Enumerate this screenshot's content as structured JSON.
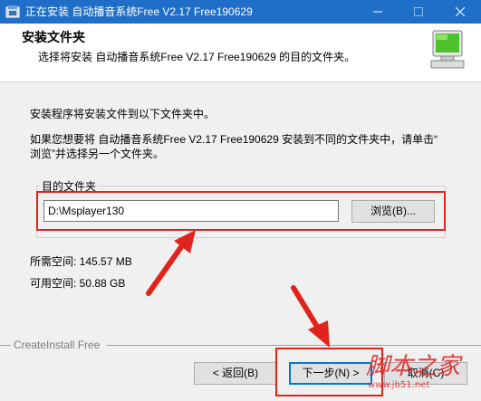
{
  "window": {
    "title": "正在安装 自动播音系统Free V2.17 Free190629"
  },
  "header": {
    "title": "安装文件夹",
    "subtitle": "选择将安装 自动播音系统Free V2.17 Free190629 的目的文件夹。"
  },
  "body": {
    "intro": "安装程序将安装文件到以下文件夹中。",
    "instruction_line1": "如果您想要将 自动播音系统Free V2.17 Free190629 安装到不同的文件夹中，请单击“",
    "instruction_line2": "浏览”并选择另一个文件夹。",
    "destination_group_label": "目的文件夹",
    "destination_path": "D:\\Msplayer130",
    "browse_label": "浏览(B)...",
    "space_required": "所需空间: 145.57 MB",
    "space_available": "可用空间: 50.88 GB"
  },
  "footer": {
    "brand": "CreateInstall Free",
    "back_label": "< 返回(B)",
    "next_label": "下一步(N) >",
    "cancel_label": "取消(C)"
  },
  "watermark": {
    "logo_text": "脚本之家",
    "url": "www.jb51.net"
  },
  "colors": {
    "titlebar": "#1f6fc8",
    "annotation": "#e0241b",
    "focus": "#0078d7"
  }
}
